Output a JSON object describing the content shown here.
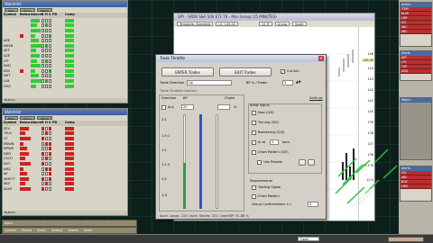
{
  "watchlist_top": {
    "title": "Watchlist",
    "tabs": [
      "Main",
      "Focus",
      "Watch"
    ],
    "columns": [
      "Symbol",
      "Below",
      "Above",
      "B",
      "H",
      "S",
      "PD",
      "Comp",
      ""
    ],
    "rows": [
      "",
      "",
      "",
      "",
      "AZE",
      "AMZN",
      "AEF",
      "AZE",
      "LTF",
      "NVD",
      "KSH",
      "NHT",
      "LLB",
      "GGG"
    ],
    "status": "Buttons"
  },
  "watchlist_bottom": {
    "title": "Watchlist",
    "tabs": [
      "Main",
      "Focus",
      "Watch"
    ],
    "columns": [
      "Symbol",
      "Below",
      "Above",
      "B",
      "H",
      "S",
      "PD",
      "Comp",
      ""
    ],
    "rows": [
      "ZEV",
      "TSLA",
      "CF",
      "MSWN",
      "MPWR",
      "DWY",
      "CSCO",
      "DVT",
      "AMZ",
      "WI",
      "WHETT",
      "WLF",
      "SLVM"
    ],
    "status": "Buttons"
  },
  "chart": {
    "title": "SPY - SPDR S&P 500 ETF TR - Mini Group (15 MINUTES)",
    "template_label": "Template: Standard",
    "price_field": "L5: 145.00",
    "interval": "15 M",
    "group_btn": "Group",
    "scale_btn": "Scale",
    "y_labels": [
      "146",
      "145.00",
      "144",
      "143",
      "142",
      "141",
      "140",
      "139",
      "138",
      "137",
      "136",
      "15.2 M",
      "10.0"
    ]
  },
  "dialog": {
    "title": "Trade Throttle",
    "enter_btn": "ENTER Trades",
    "exit_btn": "EXIT Trades",
    "cut_all_label": "Cut ALL",
    "entry_label": "Trade Direction",
    "entry_value": "Up",
    "bp_label": "BP % / Trade:",
    "bp_value": "5",
    "tab_row": "Trade Throttle Controls",
    "direction_label": "Direction",
    "bp_col_label": "BP",
    "choke_label": "Choke",
    "settings_link": "Settings",
    "any_label": "Any",
    "qty_top": "20",
    "pct_sign": "%",
    "ratio_labels": [
      "2:1",
      "1.5:1",
      "1:1",
      "1:1.5",
      "1:2",
      "1:3"
    ],
    "allow_signal_title": "Allow Signal",
    "signals": [
      {
        "label": "Now (0/0)",
        "checked": false
      },
      {
        "label": "Turning (0/0)",
        "checked": false
      },
      {
        "label": "Reentering (0/0)",
        "checked": false
      },
      {
        "label": "In at",
        "checked": false
      },
      {
        "label": "Chart Pattern (0/0)",
        "checked": false
      },
      {
        "label": "Use Presets",
        "checked": false
      }
    ],
    "in_at_value": "2",
    "in_at_suffix": "bars",
    "requirements_title": "Requirements",
    "requirements": [
      {
        "label": "Trading Signal",
        "checked": false
      },
      {
        "label": "Chart Pattern",
        "checked": false
      }
    ],
    "group_confirm_label": "Group Confirmations >=",
    "group_confirm_value": "2",
    "footer": "Avail. Longs: 222; Avail. Shorts: 222; Used BP: 31.88 %"
  },
  "right_panel": {
    "top_title": "Action",
    "top_items": [
      "ITEM",
      "BLUE",
      "LMP",
      "GG",
      "ABC",
      "ABC"
    ],
    "mid_title": "Alerts",
    "mid_items": [
      "AEF",
      "LPC",
      "TSP",
      "ADD"
    ],
    "watch_title": "Watch",
    "bottom_title": "Alerts",
    "bottom_items": [
      "CEL",
      "ABC",
      "BOE",
      "LMG"
    ]
  },
  "bottom_strip": {
    "left_label": "Input",
    "cols": [
      "Symbol",
      "Shares",
      "Score",
      "",
      "Symbol",
      "Shares",
      "Score"
    ],
    "combo_value": "Open"
  },
  "colors": {
    "desktop": "#0d1f1a",
    "signal_green": "#33cc33",
    "signal_red": "#cc2222",
    "chart_green": "#27c03a"
  }
}
